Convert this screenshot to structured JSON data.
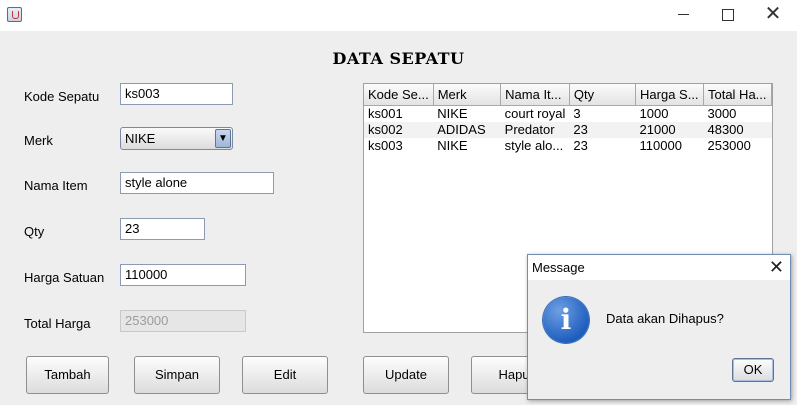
{
  "window": {
    "minimize_glyph": "",
    "maximize_glyph": "",
    "close_glyph": "✕"
  },
  "form": {
    "heading": "DATA SEPATU",
    "fields": {
      "kode_sepatu": {
        "label": "Kode Sepatu",
        "value": "ks003"
      },
      "merk": {
        "label": "Merk",
        "value": "NIKE"
      },
      "nama_item": {
        "label": "Nama Item",
        "value": "style alone"
      },
      "qty": {
        "label": "Qty",
        "value": "23"
      },
      "harga_satuan": {
        "label": "Harga Satuan",
        "value": "110000"
      },
      "total_harga": {
        "label": "Total Harga",
        "value": "253000"
      }
    },
    "buttons": {
      "tambah": "Tambah",
      "simpan": "Simpan",
      "edit": "Edit",
      "update": "Update",
      "hapus": "Hapu"
    }
  },
  "table": {
    "columns": [
      "Kode Se...",
      "Merk",
      "Nama It...",
      "Qty",
      "Harga S...",
      "Total Ha..."
    ],
    "rows": [
      [
        "ks001",
        "NIKE",
        "court royal",
        "3",
        "1000",
        "3000"
      ],
      [
        "ks002",
        "ADIDAS",
        "Predator",
        "23",
        "21000",
        "48300"
      ],
      [
        "ks003",
        "NIKE",
        "style alo...",
        "23",
        "110000",
        "253000"
      ]
    ]
  },
  "dialog": {
    "title": "Message",
    "message": "Data akan Dihapus?",
    "ok_label": "OK",
    "icon": "info-icon",
    "close_glyph": "✕"
  },
  "colors": {
    "info_icon": "#1f5fbf",
    "window_bg": "#eeeeee"
  }
}
